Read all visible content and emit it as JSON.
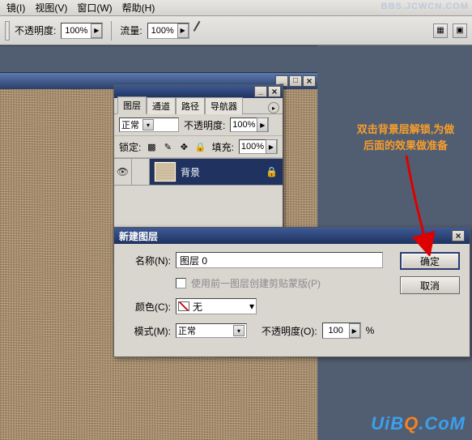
{
  "topurl": "BBS.JCWCN.COM",
  "menu": {
    "jing": "镜(I)",
    "view": "视图(V)",
    "window": "窗口(W)",
    "help": "帮助(H)"
  },
  "toolbar": {
    "opacity_label": "不透明度:",
    "opacity": "100%",
    "flow_label": "流量:",
    "flow": "100%"
  },
  "docwin": {
    "min": "_",
    "max": "□"
  },
  "layers": {
    "tabs": [
      "图层",
      "通道",
      "路径",
      "导航器"
    ],
    "active_tab": 0,
    "blend": "正常",
    "opacity_label": "不透明度:",
    "opacity": "100%",
    "lock_label": "锁定:",
    "fill_label": "填充:",
    "fill": "100%",
    "layer_name": "背景"
  },
  "dialog": {
    "title": "新建图层",
    "name_label": "名称(N):",
    "name": "图层 0",
    "clip_label": "使用前一图层创建剪贴蒙版(P)",
    "color_label": "颜色(C):",
    "color": "无",
    "mode_label": "模式(M):",
    "mode": "正常",
    "opacity_label": "不透明度(O):",
    "opacity": "100",
    "opacity_suffix": "%",
    "ok": "确定",
    "cancel": "取消"
  },
  "hint": {
    "l1": "双击背景层解锁,为做",
    "l2": "后面的效果做准备"
  },
  "watermark": {
    "pre": "UiB",
    "mid": "Q",
    "post": ".CoM"
  }
}
